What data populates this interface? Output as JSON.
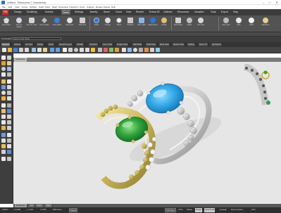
{
  "window": {
    "title": "Untitled - Rhinoceros 7 Commercial",
    "minimize": "–",
    "maximize": "□",
    "close": "✕"
  },
  "menu": [
    "File",
    "Edit",
    "View",
    "Curve",
    "Surface",
    "SubD",
    "Solid",
    "Mesh",
    "Dimension",
    "Transform",
    "Tools",
    "Analyze",
    "Render",
    "Panels",
    "Help"
  ],
  "ribbon_tabs": [
    "File",
    "Design",
    "Modelling",
    "Surface",
    "Gems",
    "Settings",
    "Jewelry",
    "Stone",
    "Cloud",
    "View",
    "Render",
    "Extras 3D",
    "Outlines",
    "Resources",
    "Visualize",
    "Tools",
    "Export",
    "Help"
  ],
  "ribbon_active_tab": "Gems",
  "ribbon_buttons": [
    {
      "label": "Gem insert",
      "color": "#d9d9d9"
    },
    {
      "label": "Gem on surface",
      "color": "#cfd8e6"
    },
    {
      "label": "Gem on curve",
      "color": "#d4d4d4"
    },
    {
      "label": "Gem creator",
      "color": "#bfbfbf"
    },
    {
      "label": "Gem studio",
      "color": "#3f7fd8"
    },
    {
      "label": "Pavé auto",
      "color": "#e3e3e3"
    },
    {
      "label": "Pavé free",
      "color": "#cfcfcf"
    },
    {
      "label": "Cutter",
      "color": "#3b6fd0"
    },
    {
      "label": "Prongs",
      "color": "#dedede"
    },
    {
      "label": "Bezel",
      "color": "#f0f0f0"
    },
    {
      "label": "Channel",
      "color": "#c8c8c8"
    },
    {
      "label": "Gem report",
      "color": "#8ab4e8"
    },
    {
      "label": "Select gems",
      "color": "#2c74d8"
    },
    {
      "label": "Heads",
      "color": "#e0c070"
    },
    {
      "label": "Gem library",
      "color": "#d0d0d0"
    },
    {
      "label": "Claws",
      "color": "#c0c0c0"
    },
    {
      "label": "Gem info",
      "color": "#d8d8d8"
    },
    {
      "label": "Gem color",
      "color": "#bcbcbc"
    },
    {
      "label": "Halo",
      "color": "#e8e8e8"
    },
    {
      "label": "Pearl",
      "color": "#f2f2f2"
    },
    {
      "label": "Cabochon",
      "color": "#e4d090"
    }
  ],
  "command": {
    "label": "Command:",
    "value": "Cancel | Undo | Redo"
  },
  "tool_tabs": [
    "Standard",
    "CPlanes",
    "Set View",
    "Display",
    "Select",
    "Viewport Layout",
    "Visibility",
    "Transform",
    "Curve Tools",
    "Surface Tools",
    "Solid Tools",
    "SubD Tools",
    "Mesh Tools",
    "Render Tools",
    "Drafting",
    "New in V7",
    "Gemstones"
  ],
  "viewport": {
    "tab": "Perspective"
  },
  "bottom_tabs": [
    "Perspective",
    "Top",
    "Front",
    "Right"
  ],
  "status": {
    "cplane": "CPlane",
    "coords": [
      "x 12.484",
      "y -4.291",
      "z 0.000"
    ],
    "units": "Millimeters",
    "layer": "Default",
    "toggles": [
      "Grid Snap",
      "Ortho",
      "Planar",
      "Osnap",
      "SmartTrack",
      "Gumball",
      "Record History",
      "Filter"
    ]
  },
  "scene": {
    "front_gem_color": "#2ea43a",
    "back_gem_color": "#33a8e6",
    "front_band_color": "#c8b45a",
    "back_band_color": "#d9d9d9",
    "viewport_bg": "#e6e6e6"
  }
}
